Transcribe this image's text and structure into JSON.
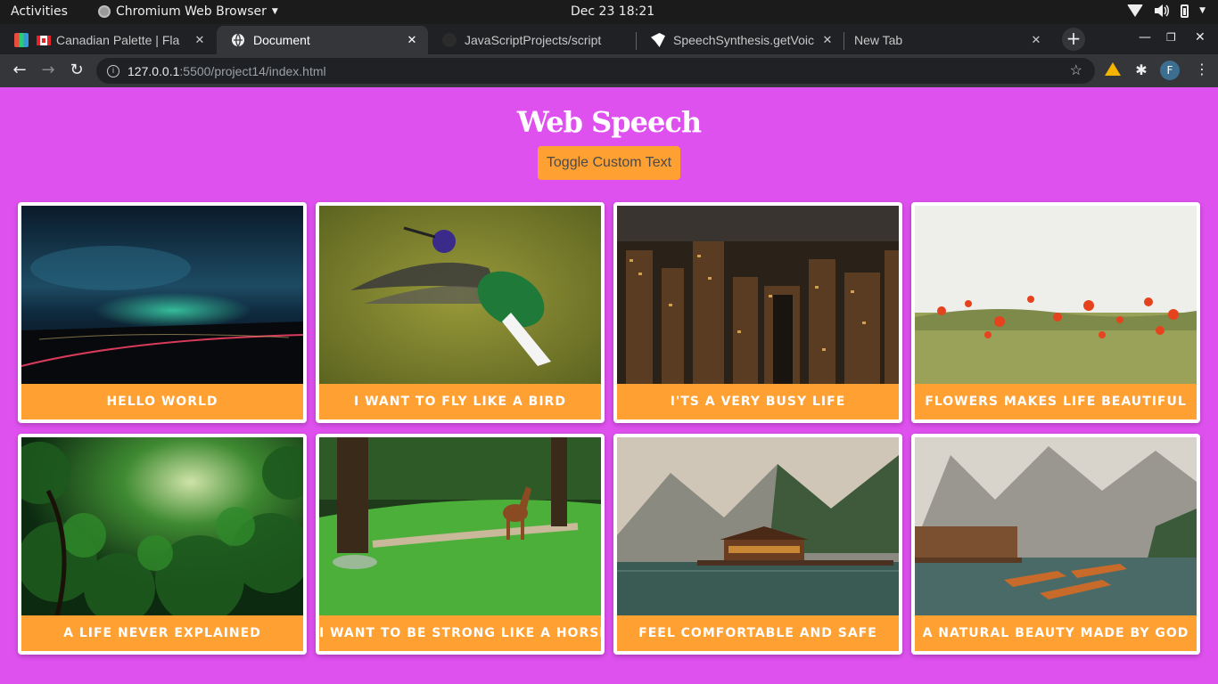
{
  "system_bar": {
    "activities": "Activities",
    "app_name": "Chromium Web Browser",
    "clock": "Dec 23  18:21"
  },
  "tabs": [
    {
      "title": "Canadian Palette | Fla",
      "active": false,
      "favicon": "flatuicolors-favicon"
    },
    {
      "title": "Document",
      "active": true,
      "favicon": "globe-icon"
    },
    {
      "title": "JavaScriptProjects/script",
      "active": false,
      "favicon": "github-icon"
    },
    {
      "title": "SpeechSynthesis.getVoic",
      "active": false,
      "favicon": "mdn-icon"
    },
    {
      "title": "New Tab",
      "active": false,
      "favicon": ""
    }
  ],
  "toolbar": {
    "url_host": "127.0.0.1",
    "url_path": ":5500/project14/index.html",
    "profile_initial": "F"
  },
  "page": {
    "title": "Web Speech",
    "toggle_button": "Toggle Custom Text",
    "background": "#df51ef",
    "accent": "#ffa033",
    "cards": [
      {
        "caption": "Hello World",
        "image": "night-sky-landscape"
      },
      {
        "caption": "I Want To Fly Like A Bird",
        "image": "hummingbird"
      },
      {
        "caption": "I'ts A Very Busy Life",
        "image": "city-at-night"
      },
      {
        "caption": "Flowers Makes Life Beautiful",
        "image": "poppy-field"
      },
      {
        "caption": "A Life Never Explained",
        "image": "rainforest"
      },
      {
        "caption": "I Want To Be Strong Like A Horse",
        "image": "horse-in-meadow"
      },
      {
        "caption": "Feel Comfortable And Safe",
        "image": "lake-cabin-mountains"
      },
      {
        "caption": "A Natural Beauty Made By God",
        "image": "lake-boats-mountains"
      }
    ]
  }
}
